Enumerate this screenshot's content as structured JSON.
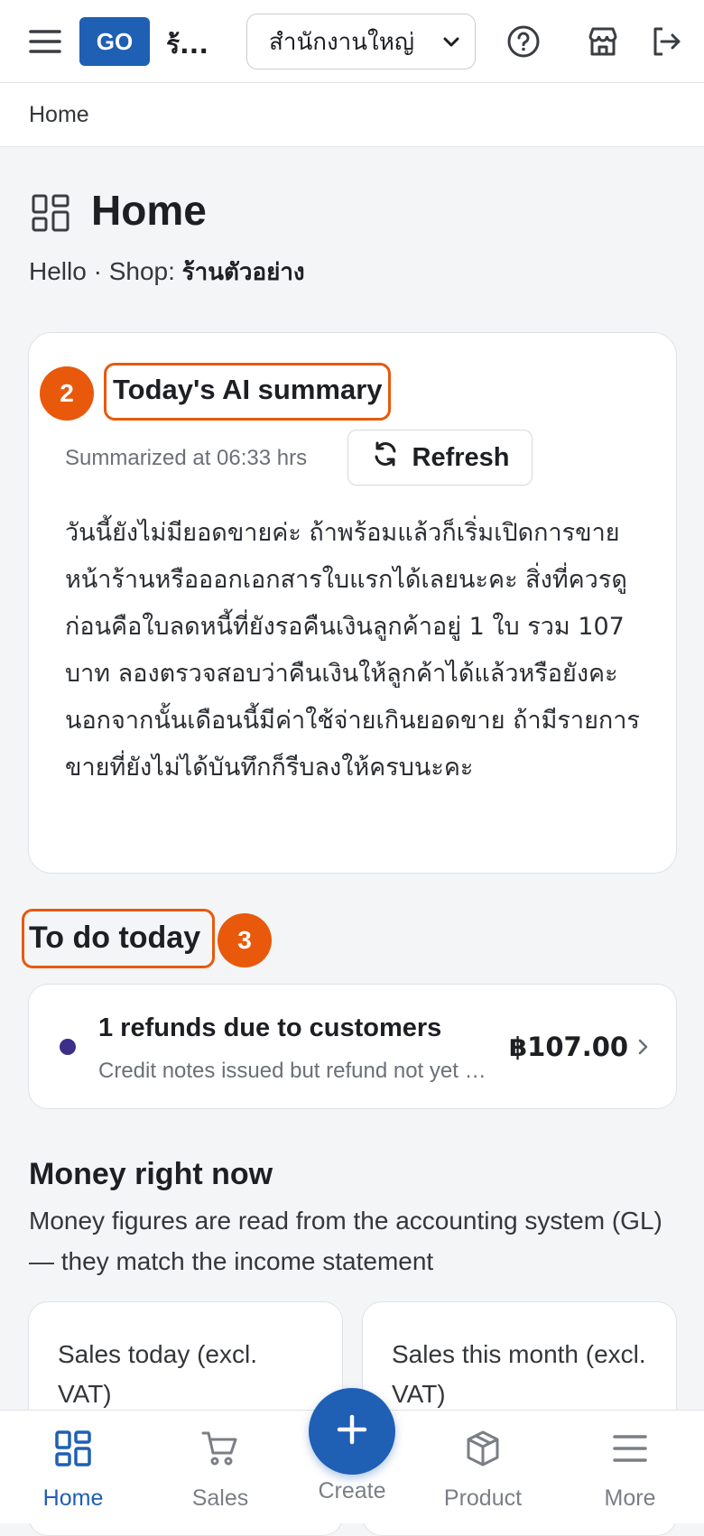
{
  "header": {
    "logo_text": "GO",
    "shop_short": "ร้...",
    "branch_selected": "สำนักงานใหญ่",
    "icons": [
      "menu-icon",
      "help-icon",
      "store-icon",
      "logout-icon"
    ]
  },
  "breadcrumb": "Home",
  "page": {
    "title": "Home",
    "greeting_prefix": "Hello · Shop: ",
    "shop_name": "ร้านตัวอย่าง"
  },
  "ai_summary": {
    "step": "2",
    "title": "Today's AI summary",
    "summarized_at": "Summarized at 06:33 hrs",
    "refresh_label": "Refresh",
    "text": "วันนี้ยังไม่มียอดขายค่ะ ถ้าพร้อมแล้วก็เริ่มเปิดการขายหน้าร้านหรือออกเอกสารใบแรกได้เลยนะคะ สิ่งที่ควรดูก่อนคือใบลดหนี้ที่ยังรอคืนเงินลูกค้าอยู่ 1 ใบ รวม 107 บาท ลองตรวจสอบว่าคืนเงินให้ลูกค้าได้แล้วหรือยังคะ นอกจากนั้นเดือนนี้มีค่าใช้จ่ายเกินยอดขาย ถ้ามีรายการขายที่ยังไม่ได้บันทึกก็รีบลงให้ครบนะคะ"
  },
  "todo": {
    "step": "3",
    "title": "To do today",
    "items": [
      {
        "title": "1 refunds due to customers",
        "subtitle": "Credit notes issued but refund not yet paid",
        "amount": "฿107.00"
      }
    ]
  },
  "money": {
    "title": "Money right now",
    "description": "Money figures are read from the accounting system (GL) — they match the income statement",
    "cards": [
      {
        "label": "Sales today (excl. VAT)"
      },
      {
        "label": "Sales this month (excl. VAT)"
      }
    ]
  },
  "nav": {
    "home": "Home",
    "sales": "Sales",
    "create": "Create",
    "product": "Product",
    "more": "More"
  },
  "colors": {
    "primary": "#1f5fb4",
    "accent_orange": "#e8590c",
    "todo_dot": "#3b2f8a"
  }
}
